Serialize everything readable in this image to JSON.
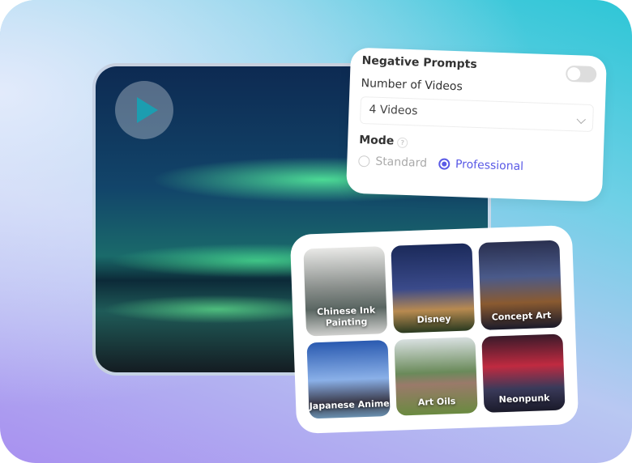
{
  "settings": {
    "negative_prompts_label": "Negative Prompts",
    "negative_prompts_enabled": false,
    "number_label": "Number of Videos",
    "number_value": "4 Videos",
    "mode_label": "Mode",
    "modes": [
      {
        "label": "Standard",
        "selected": false
      },
      {
        "label": "Professional",
        "selected": true
      }
    ]
  },
  "styles": [
    {
      "label": "Chinese Ink Painting",
      "bg": "linear-gradient(180deg,#e8e8e6,#8a8f8c 45%,#5a6662 70%,#cfcfcd)"
    },
    {
      "label": "Disney",
      "bg": "linear-gradient(180deg,#1b2a5a,#3a4a8a 50%,#b88a50 75%,#2a3a20)"
    },
    {
      "label": "Concept Art",
      "bg": "linear-gradient(180deg,#2a3050,#4a5a8a 40%,#8a5a30 70%,#1a1a2a)"
    },
    {
      "label": "Japanese Anime",
      "bg": "linear-gradient(180deg,#2a5ab0,#8ab0e8 50%,#3a3a4a 80%,#6a90b0)"
    },
    {
      "label": "Art Oils",
      "bg": "linear-gradient(180deg,#d8e0e0,#6a8a5a 45%,#9a7a6a 60%,#6a8a40)"
    },
    {
      "label": "Neonpunk",
      "bg": "linear-gradient(180deg,#3a1a2a,#c02a40 40%,#3a3a5a 70%,#1a1a2a)"
    }
  ],
  "colors": {
    "accent": "#5a5ae6",
    "play": "#1c9db0"
  }
}
